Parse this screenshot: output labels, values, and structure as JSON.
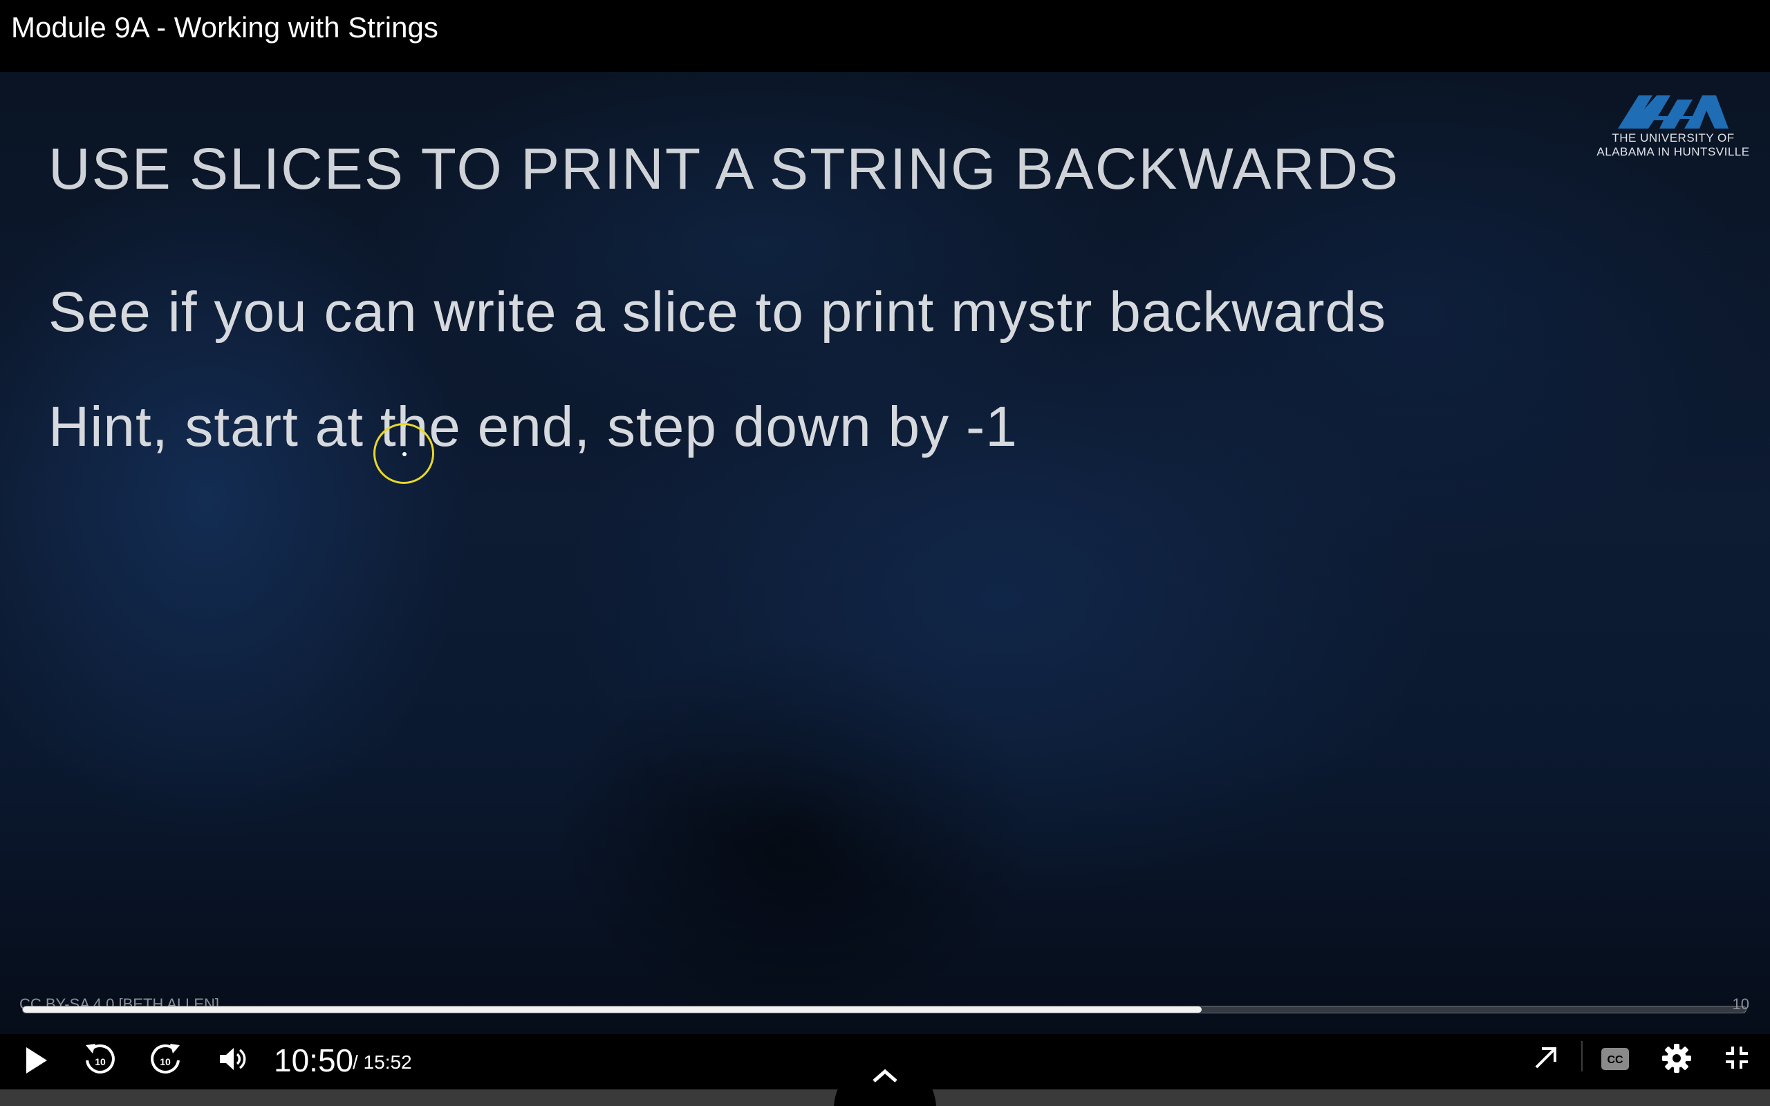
{
  "window": {
    "title": "Module 9A - Working with Strings"
  },
  "slide": {
    "heading": "USE SLICES TO PRINT A STRING BACKWARDS",
    "lines": [
      "See if you can write a slice to print mystr backwards",
      "Hint, start at the end, step down by -1"
    ],
    "logo": {
      "mark": "UAH",
      "line1": "THE UNIVERSITY OF",
      "line2": "ALABAMA IN HUNTSVILLE",
      "color": "#1f6db5"
    },
    "license": "CC BY-SA 4.0 [BETH ALLEN]",
    "number": "10",
    "cursor_highlight_color": "#e8d82a"
  },
  "player": {
    "progress_fraction": 0.684,
    "current_time": "10:50",
    "total_time": "/ 15:52",
    "controls": {
      "play": "play-icon",
      "rewind": "rewind-10-icon",
      "forward": "forward-10-icon",
      "volume": "volume-icon",
      "skip_label": "10",
      "popout": "popout-icon",
      "captions": "captions-icon",
      "settings": "gear-icon",
      "exit_fullscreen": "exit-fullscreen-icon",
      "drawer": "chevron-up-icon"
    }
  }
}
